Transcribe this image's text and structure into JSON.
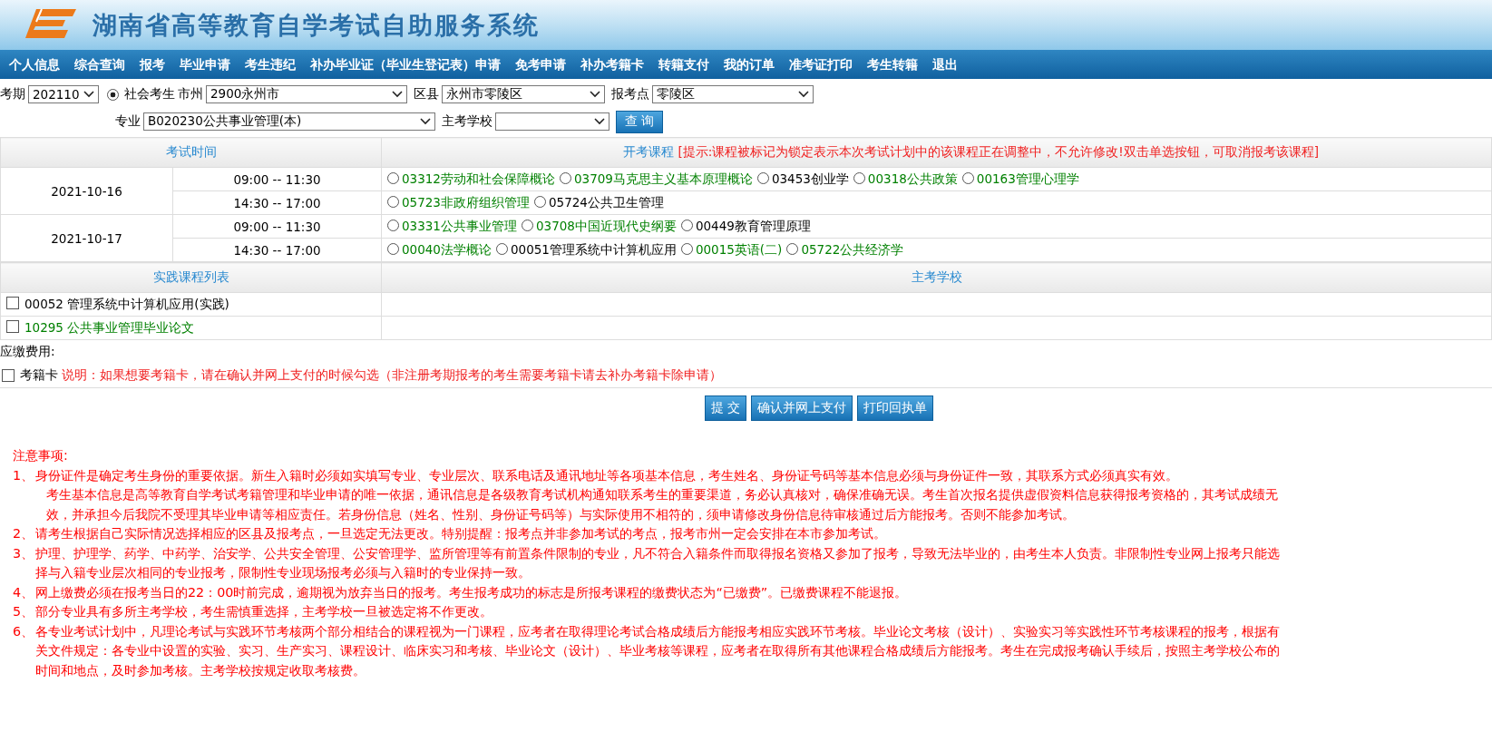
{
  "header": {
    "title": "湖南省高等教育自学考试自助服务系统"
  },
  "nav": [
    "个人信息",
    "综合查询",
    "报考",
    "毕业申请",
    "考生违纪",
    "补办毕业证（毕业生登记表）申请",
    "免考申请",
    "补办考籍卡",
    "转籍支付",
    "我的订单",
    "准考证打印",
    "考生转籍",
    "退出"
  ],
  "filters": {
    "exam_period": {
      "label": "考期",
      "value": "202110"
    },
    "candidate_type": {
      "label": "社会考生",
      "selected": true
    },
    "city": {
      "label": "市州",
      "value": "2900永州市"
    },
    "county": {
      "label": "区县",
      "value": "永州市零陵区"
    },
    "exam_site": {
      "label": "报考点",
      "value": "零陵区"
    },
    "major": {
      "label": "专业",
      "value": "B020230公共事业管理(本)"
    },
    "school": {
      "label": "主考学校"
    },
    "query_button": "查 询"
  },
  "schedule": {
    "time_heading": "考试时间",
    "course_heading": "开考课程",
    "notice": "[提示:课程被标记为锁定表示本次考试计划中的该课程正在调整中，不允许修改!双击单选按钮，可取消报考该课程]",
    "days": [
      {
        "date": "2021-10-16",
        "sessions": [
          {
            "time": "09:00 -- 11:30",
            "courses": [
              {
                "name": "03312劳动和社会保障概论",
                "color": "#008000",
                "selected": false
              },
              {
                "name": "03709马克思主义基本原理概论",
                "color": "#008000",
                "selected": false
              },
              {
                "name": "03453创业学",
                "color": "#000000",
                "selected": false
              },
              {
                "name": "00318公共政策",
                "color": "#008000",
                "selected": false
              },
              {
                "name": "00163管理心理学",
                "color": "#008000",
                "selected": false
              }
            ]
          },
          {
            "time": "14:30 -- 17:00",
            "courses": [
              {
                "name": "05723非政府组织管理",
                "color": "#008000",
                "selected": false
              },
              {
                "name": "05724公共卫生管理",
                "color": "#000000",
                "selected": false
              }
            ]
          }
        ]
      },
      {
        "date": "2021-10-17",
        "sessions": [
          {
            "time": "09:00 -- 11:30",
            "courses": [
              {
                "name": "03331公共事业管理",
                "color": "#008000",
                "selected": false
              },
              {
                "name": "03708中国近现代史纲要",
                "color": "#008000",
                "selected": false
              },
              {
                "name": "00449教育管理原理",
                "color": "#000000",
                "selected": false
              }
            ]
          },
          {
            "time": "14:30 -- 17:00",
            "courses": [
              {
                "name": "00040法学概论",
                "color": "#008000",
                "selected": false
              },
              {
                "name": "00051管理系统中计算机应用",
                "color": "#000000",
                "selected": false
              },
              {
                "name": "00015英语(二)",
                "color": "#008000",
                "selected": false
              },
              {
                "name": "05722公共经济学",
                "color": "#008000",
                "selected": false
              }
            ]
          }
        ]
      }
    ]
  },
  "practice": {
    "list_heading": "实践课程列表",
    "school_heading": "主考学校",
    "courses": [
      {
        "name": "00052 管理系统中计算机应用(实践)",
        "color": "#000000",
        "checked": false
      },
      {
        "name": "10295 公共事业管理毕业论文",
        "color": "#008000",
        "checked": false
      }
    ]
  },
  "fee_label": "应缴费用:",
  "card": {
    "label": "考籍卡",
    "checked": false,
    "note": "说明：如果想要考籍卡，请在确认并网上支付的时候勾选（非注册考期报考的考生需要考籍卡请去补办考籍卡除申请）"
  },
  "buttons": [
    "提 交",
    "确认并网上支付",
    "打印回执单"
  ],
  "notes": {
    "title": "注意事项:",
    "items": [
      {
        "number": "1、",
        "text": "身份证件是确定考生身份的重要依据。新生入籍时必须如实填写专业、专业层次、联系电话及通讯地址等各项基本信息，考生姓名、身份证号码等基本信息必须与身份证件一致，其联系方式必须真实有效。"
      },
      {
        "text": "考生基本信息是高等教育自学考试考籍管理和毕业申请的唯一依据，通讯信息是各级教育考试机构通知联系考生的重要渠道，务必认真核对，确保准确无误。考生首次报名提供虚假资料信息获得报考资格的，其考试成绩无效，并承担今后我院不受理其毕业申请等相应责任。若身份信息（姓名、性别、身份证号码等）与实际使用不相符的，须申请修改身份信息待审核通过后方能报考。否则不能参加考试。"
      },
      {
        "number": "2、",
        "text": "请考生根据自己实际情况选择相应的区县及报考点，一旦选定无法更改。特别提醒：报考点并非参加考试的考点，报考市州一定会安排在本市参加考试。"
      },
      {
        "number": "3、",
        "text": "护理、护理学、药学、中药学、治安学、公共安全管理、公安管理学、监所管理等有前置条件限制的专业，凡不符合入籍条件而取得报名资格又参加了报考，导致无法毕业的，由考生本人负责。非限制性专业网上报考只能选择与入籍专业层次相同的专业报考，限制性专业现场报考必须与入籍时的专业保持一致。"
      },
      {
        "number": "4、",
        "text": "网上缴费必须在报考当日的22：00时前完成，逾期视为放弃当日的报考。考生报考成功的标志是所报考课程的缴费状态为“已缴费”。已缴费课程不能退报。"
      },
      {
        "number": "5、",
        "text": "部分专业具有多所主考学校，考生需慎重选择，主考学校一旦被选定将不作更改。"
      },
      {
        "number": "6、",
        "text": "各专业考试计划中，凡理论考试与实践环节考核两个部分相结合的课程视为一门课程，应考者在取得理论考试合格成绩后方能报考相应实践环节考核。毕业论文考核（设计）、实验实习等实践性环节考核课程的报考，根据有关文件规定：各专业中设置的实验、实习、生产实习、课程设计、临床实习和考核、毕业论文（设计）、毕业考核等课程，应考者在取得所有其他课程合格成绩后方能报考。考生在完成报考确认手续后，按照主考学校公布的时间和地点，及时参加考核。主考学校按规定收取考核费。"
      }
    ]
  }
}
